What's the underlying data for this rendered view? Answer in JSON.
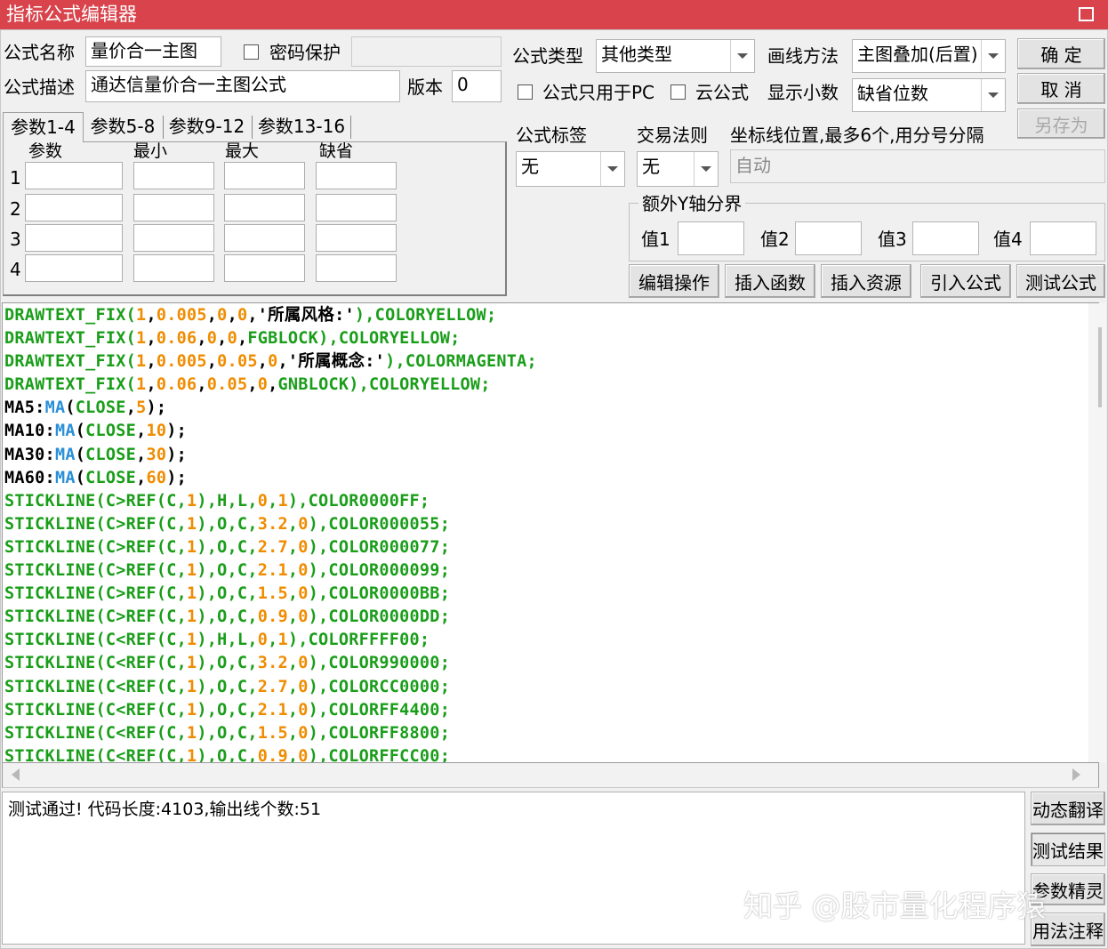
{
  "window": {
    "title": "指标公式编辑器"
  },
  "form": {
    "name_label": "公式名称",
    "name_value": "量价合一主图",
    "password_label": "密码保护",
    "password_value": "",
    "desc_label": "公式描述",
    "desc_value": "通达信量价合一主图公式",
    "version_label": "版本",
    "version_value": "0",
    "type_label": "公式类型",
    "type_value": "其他类型",
    "draw_label": "画线方法",
    "draw_value": "主图叠加(后置)",
    "pc_only_label": "公式只用于PC",
    "cloud_label": "云公式",
    "decimals_label": "显示小数",
    "decimals_value": "缺省位数",
    "tag_label": "公式标签",
    "tag_value": "无",
    "trade_label": "交易法则",
    "trade_value": "无",
    "coord_label": "坐标线位置,最多6个,用分号分隔",
    "coord_value": "自动",
    "yaxis_group_label": "额外Y轴分界",
    "yaxis_values": [
      "值1",
      "值2",
      "值3",
      "值4"
    ]
  },
  "buttons": {
    "ok": "确  定",
    "cancel": "取  消",
    "save_as": "另存为",
    "edit_ops": "编辑操作",
    "insert_func": "插入函数",
    "insert_res": "插入资源",
    "import_formula": "引入公式",
    "test_formula": "测试公式",
    "dynamic_translate": "动态翻译",
    "test_result": "测试结果",
    "param_wizard": "参数精灵",
    "usage_notes": "用法注释"
  },
  "param_tabs": [
    "参数1-4",
    "参数5-8",
    "参数9-12",
    "参数13-16"
  ],
  "param_headers": [
    "参数",
    "最小",
    "最大",
    "缺省"
  ],
  "param_rows": [
    "1",
    "2",
    "3",
    "4"
  ],
  "colors": {
    "title_bar": "#d9434b",
    "code_green": "#1a9e1a",
    "code_orange": "#f08c00",
    "code_blue": "#2a8fd8",
    "code_black": "#000000"
  },
  "code_lines": [
    [
      [
        "DRAWTEXT_FIX(",
        "g"
      ],
      [
        "1",
        "o"
      ],
      [
        ",",
        "k"
      ],
      [
        "0.005",
        "o"
      ],
      [
        ",",
        "k"
      ],
      [
        "0",
        "o"
      ],
      [
        ",",
        "k"
      ],
      [
        "0",
        "o"
      ],
      [
        ",",
        "k"
      ],
      [
        "'所属风格:'",
        "k"
      ],
      [
        "),COLORYELLOW;",
        "g"
      ]
    ],
    [
      [
        "DRAWTEXT_FIX(",
        "g"
      ],
      [
        "1",
        "o"
      ],
      [
        ",",
        "k"
      ],
      [
        "0.06",
        "o"
      ],
      [
        ",",
        "k"
      ],
      [
        "0",
        "o"
      ],
      [
        ",",
        "k"
      ],
      [
        "0",
        "o"
      ],
      [
        ",",
        "k"
      ],
      [
        "FGBLOCK",
        "g"
      ],
      [
        "),COLORYELLOW;",
        "g"
      ]
    ],
    [
      [
        "DRAWTEXT_FIX(",
        "g"
      ],
      [
        "1",
        "o"
      ],
      [
        ",",
        "k"
      ],
      [
        "0.005",
        "o"
      ],
      [
        ",",
        "k"
      ],
      [
        "0.05",
        "o"
      ],
      [
        ",",
        "k"
      ],
      [
        "0",
        "o"
      ],
      [
        ",",
        "k"
      ],
      [
        "'所属概念:'",
        "k"
      ],
      [
        "),COLORMAGENTA;",
        "g"
      ]
    ],
    [
      [
        "DRAWTEXT_FIX(",
        "g"
      ],
      [
        "1",
        "o"
      ],
      [
        ",",
        "k"
      ],
      [
        "0.06",
        "o"
      ],
      [
        ",",
        "k"
      ],
      [
        "0.05",
        "o"
      ],
      [
        ",",
        "k"
      ],
      [
        "0",
        "o"
      ],
      [
        ",",
        "k"
      ],
      [
        "GNBLOCK",
        "g"
      ],
      [
        "),COLORYELLOW;",
        "g"
      ]
    ],
    [
      [
        "MA5:",
        "k"
      ],
      [
        "MA",
        "b"
      ],
      [
        "(",
        "k"
      ],
      [
        "CLOSE",
        "g"
      ],
      [
        ",",
        "k"
      ],
      [
        "5",
        "o"
      ],
      [
        ");",
        "k"
      ]
    ],
    [
      [
        "MA10:",
        "k"
      ],
      [
        "MA",
        "b"
      ],
      [
        "(",
        "k"
      ],
      [
        "CLOSE",
        "g"
      ],
      [
        ",",
        "k"
      ],
      [
        "10",
        "o"
      ],
      [
        ");",
        "k"
      ]
    ],
    [
      [
        "MA30:",
        "k"
      ],
      [
        "MA",
        "b"
      ],
      [
        "(",
        "k"
      ],
      [
        "CLOSE",
        "g"
      ],
      [
        ",",
        "k"
      ],
      [
        "30",
        "o"
      ],
      [
        ");",
        "k"
      ]
    ],
    [
      [
        "MA60:",
        "k"
      ],
      [
        "MA",
        "b"
      ],
      [
        "(",
        "k"
      ],
      [
        "CLOSE",
        "g"
      ],
      [
        ",",
        "k"
      ],
      [
        "60",
        "o"
      ],
      [
        ");",
        "k"
      ]
    ],
    [
      [
        "STICKLINE(C>REF(C,",
        "g"
      ],
      [
        "1",
        "o"
      ],
      [
        "),H,L,",
        "g"
      ],
      [
        "0",
        "o"
      ],
      [
        ",",
        "g"
      ],
      [
        "1",
        "o"
      ],
      [
        "),COLOR0000FF;",
        "g"
      ]
    ],
    [
      [
        "STICKLINE(C>REF(C,",
        "g"
      ],
      [
        "1",
        "o"
      ],
      [
        "),O,C,",
        "g"
      ],
      [
        "3.2",
        "o"
      ],
      [
        ",",
        "g"
      ],
      [
        "0",
        "o"
      ],
      [
        "),COLOR000055;",
        "g"
      ]
    ],
    [
      [
        "STICKLINE(C>REF(C,",
        "g"
      ],
      [
        "1",
        "o"
      ],
      [
        "),O,C,",
        "g"
      ],
      [
        "2.7",
        "o"
      ],
      [
        ",",
        "g"
      ],
      [
        "0",
        "o"
      ],
      [
        "),COLOR000077;",
        "g"
      ]
    ],
    [
      [
        "STICKLINE(C>REF(C,",
        "g"
      ],
      [
        "1",
        "o"
      ],
      [
        "),O,C,",
        "g"
      ],
      [
        "2.1",
        "o"
      ],
      [
        ",",
        "g"
      ],
      [
        "0",
        "o"
      ],
      [
        "),COLOR000099;",
        "g"
      ]
    ],
    [
      [
        "STICKLINE(C>REF(C,",
        "g"
      ],
      [
        "1",
        "o"
      ],
      [
        "),O,C,",
        "g"
      ],
      [
        "1.5",
        "o"
      ],
      [
        ",",
        "g"
      ],
      [
        "0",
        "o"
      ],
      [
        "),COLOR0000BB;",
        "g"
      ]
    ],
    [
      [
        "STICKLINE(C>REF(C,",
        "g"
      ],
      [
        "1",
        "o"
      ],
      [
        "),O,C,",
        "g"
      ],
      [
        "0.9",
        "o"
      ],
      [
        ",",
        "g"
      ],
      [
        "0",
        "o"
      ],
      [
        "),COLOR0000DD;",
        "g"
      ]
    ],
    [
      [
        "STICKLINE(C<REF(C,",
        "g"
      ],
      [
        "1",
        "o"
      ],
      [
        "),H,L,",
        "g"
      ],
      [
        "0",
        "o"
      ],
      [
        ",",
        "g"
      ],
      [
        "1",
        "o"
      ],
      [
        "),COLORFFFF00;",
        "g"
      ]
    ],
    [
      [
        "STICKLINE(C<REF(C,",
        "g"
      ],
      [
        "1",
        "o"
      ],
      [
        "),O,C,",
        "g"
      ],
      [
        "3.2",
        "o"
      ],
      [
        ",",
        "g"
      ],
      [
        "0",
        "o"
      ],
      [
        "),COLOR990000;",
        "g"
      ]
    ],
    [
      [
        "STICKLINE(C<REF(C,",
        "g"
      ],
      [
        "1",
        "o"
      ],
      [
        "),O,C,",
        "g"
      ],
      [
        "2.7",
        "o"
      ],
      [
        ",",
        "g"
      ],
      [
        "0",
        "o"
      ],
      [
        "),COLORCC0000;",
        "g"
      ]
    ],
    [
      [
        "STICKLINE(C<REF(C,",
        "g"
      ],
      [
        "1",
        "o"
      ],
      [
        "),O,C,",
        "g"
      ],
      [
        "2.1",
        "o"
      ],
      [
        ",",
        "g"
      ],
      [
        "0",
        "o"
      ],
      [
        "),COLORFF4400;",
        "g"
      ]
    ],
    [
      [
        "STICKLINE(C<REF(C,",
        "g"
      ],
      [
        "1",
        "o"
      ],
      [
        "),O,C,",
        "g"
      ],
      [
        "1.5",
        "o"
      ],
      [
        ",",
        "g"
      ],
      [
        "0",
        "o"
      ],
      [
        "),COLORFF8800;",
        "g"
      ]
    ],
    [
      [
        "STICKLINE(C<REF(C,",
        "g"
      ],
      [
        "1",
        "o"
      ],
      [
        "),O,C,",
        "g"
      ],
      [
        "0.9",
        "o"
      ],
      [
        ",",
        "g"
      ],
      [
        "0",
        "o"
      ],
      [
        "),COLORFFCC00;",
        "g"
      ]
    ]
  ],
  "test_output": "测试通过! 代码长度:4103,输出线个数:51",
  "watermark": "知乎 @股市量化程序猿"
}
